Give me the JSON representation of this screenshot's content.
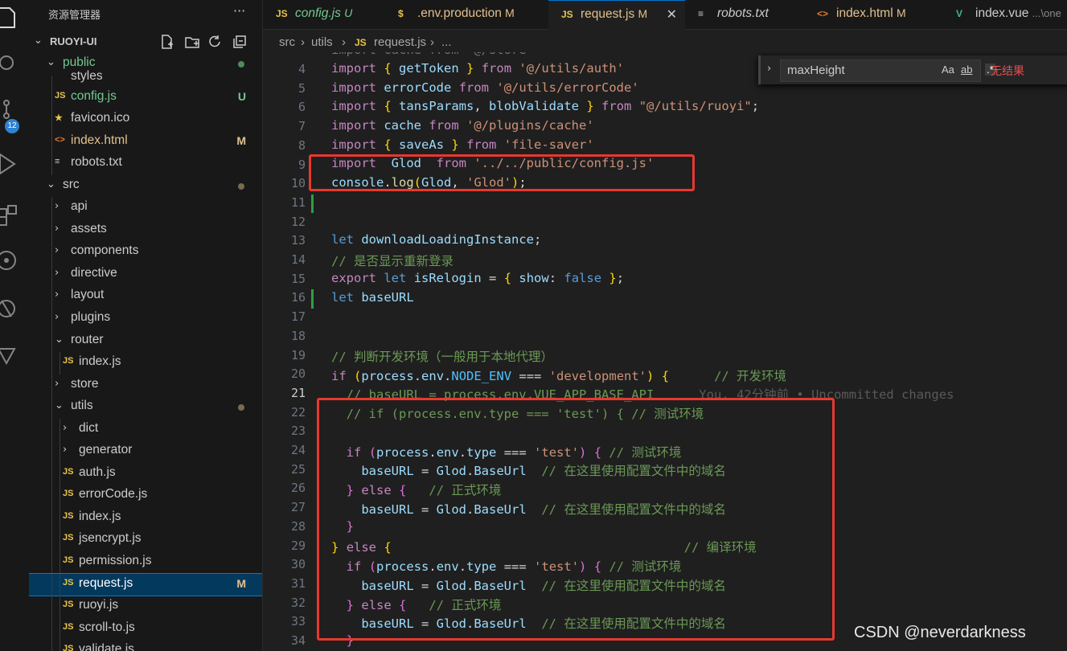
{
  "activity_bar": {
    "scm_badge": "12"
  },
  "explorer": {
    "title": "资源管理器",
    "root": "RUOYI-UI",
    "items": [
      {
        "name": "public",
        "kind": "folder-open",
        "depth": 1,
        "status": "dot",
        "name_color": "#73c991"
      },
      {
        "name": "styles",
        "kind": "partial",
        "depth": 2
      },
      {
        "name": "config.js",
        "kind": "js",
        "depth": 2,
        "status": "U",
        "name_color": "#73c991"
      },
      {
        "name": "favicon.ico",
        "kind": "star",
        "depth": 2
      },
      {
        "name": "index.html",
        "kind": "html",
        "depth": 2,
        "status": "M",
        "name_color": "#e2c08d"
      },
      {
        "name": "robots.txt",
        "kind": "txt",
        "depth": 2
      },
      {
        "name": "src",
        "kind": "folder-open",
        "depth": 1,
        "status": "dot"
      },
      {
        "name": "api",
        "kind": "folder",
        "depth": 2
      },
      {
        "name": "assets",
        "kind": "folder",
        "depth": 2
      },
      {
        "name": "components",
        "kind": "folder",
        "depth": 2
      },
      {
        "name": "directive",
        "kind": "folder",
        "depth": 2
      },
      {
        "name": "layout",
        "kind": "folder",
        "depth": 2
      },
      {
        "name": "plugins",
        "kind": "folder",
        "depth": 2
      },
      {
        "name": "router",
        "kind": "folder-open",
        "depth": 2
      },
      {
        "name": "index.js",
        "kind": "js",
        "depth": 3
      },
      {
        "name": "store",
        "kind": "folder",
        "depth": 2
      },
      {
        "name": "utils",
        "kind": "folder-open",
        "depth": 2,
        "status": "dot"
      },
      {
        "name": "dict",
        "kind": "folder",
        "depth": 3
      },
      {
        "name": "generator",
        "kind": "folder",
        "depth": 3
      },
      {
        "name": "auth.js",
        "kind": "js",
        "depth": 3
      },
      {
        "name": "errorCode.js",
        "kind": "js",
        "depth": 3
      },
      {
        "name": "index.js",
        "kind": "js",
        "depth": 3
      },
      {
        "name": "jsencrypt.js",
        "kind": "js",
        "depth": 3
      },
      {
        "name": "permission.js",
        "kind": "js",
        "depth": 3
      },
      {
        "name": "request.js",
        "kind": "js",
        "depth": 3,
        "status": "M",
        "selected": true
      },
      {
        "name": "ruoyi.js",
        "kind": "js",
        "depth": 3
      },
      {
        "name": "scroll-to.js",
        "kind": "js",
        "depth": 3
      },
      {
        "name": "validate.js",
        "kind": "js",
        "depth": 3
      }
    ]
  },
  "tabs": [
    {
      "icon": "JS",
      "label": "config.js",
      "status": "U",
      "color": "#73c991",
      "italic": true
    },
    {
      "icon": "$",
      "label": ".env.production",
      "status": "M",
      "color": "#e2c08d",
      "italic": false
    },
    {
      "icon": "JS",
      "label": "request.js",
      "status": "M",
      "color": "#e2c08d",
      "italic": false,
      "active": true
    },
    {
      "icon": "≡",
      "label": "robots.txt",
      "status": "",
      "color": "#cccccc",
      "italic": true
    },
    {
      "icon": "<>",
      "label": "index.html",
      "status": "M",
      "color": "#e2c08d",
      "italic": false
    },
    {
      "icon": "V",
      "label": "index.vue",
      "status": "...\\one",
      "color": "#cccccc",
      "italic": false
    }
  ],
  "breadcrumb": {
    "part1": "src",
    "part2": "utils",
    "icon": "JS",
    "part3": "request.js",
    "part4": "..."
  },
  "find_widget": {
    "query": "maxHeight",
    "match_case": "Aa",
    "whole_word": "ab",
    "regex": ".*",
    "result": "无结果"
  },
  "editor": {
    "line_numbers": [
      "4",
      "5",
      "6",
      "7",
      "8",
      "9",
      "10",
      "11",
      "12",
      "13",
      "14",
      "15",
      "16",
      "17",
      "18",
      "19",
      "20",
      "21",
      "22",
      "23",
      "24",
      "25",
      "26",
      "27",
      "28",
      "29",
      "30",
      "31",
      "32",
      "33",
      "34"
    ],
    "blame": "You, 42分钟前 • Uncommitted changes",
    "strings": {
      "p_auth": "'@/utils/auth'",
      "p_err": "'@/utils/errorCode'",
      "p_ruoyi": "\"@/utils/ruoyi\"",
      "p_cache": "'@/plugins/cache'",
      "p_fs": "'file-saver'",
      "p_cfg": "'../../public/config.js'",
      "s_glod": "'Glod'",
      "s_dev": "'development'",
      "s_test": "'test'"
    },
    "comments": {
      "relogin": "// 是否显示重新登录",
      "judge": "// 判断开发环境（一般用于本地代理）",
      "dev": "// 开发环境",
      "base_api": "// baseURL = process.env.VUE_APP_BASE_API",
      "if_test": "// if (process.env.type === 'test') { // 测试环境",
      "test": "// 测试环境",
      "cfg": "// 在这里使用配置文件中的域名",
      "prod": "// 正式环境",
      "compile": "// 编译环境"
    }
  },
  "watermark": "CSDN @neverdarkness"
}
